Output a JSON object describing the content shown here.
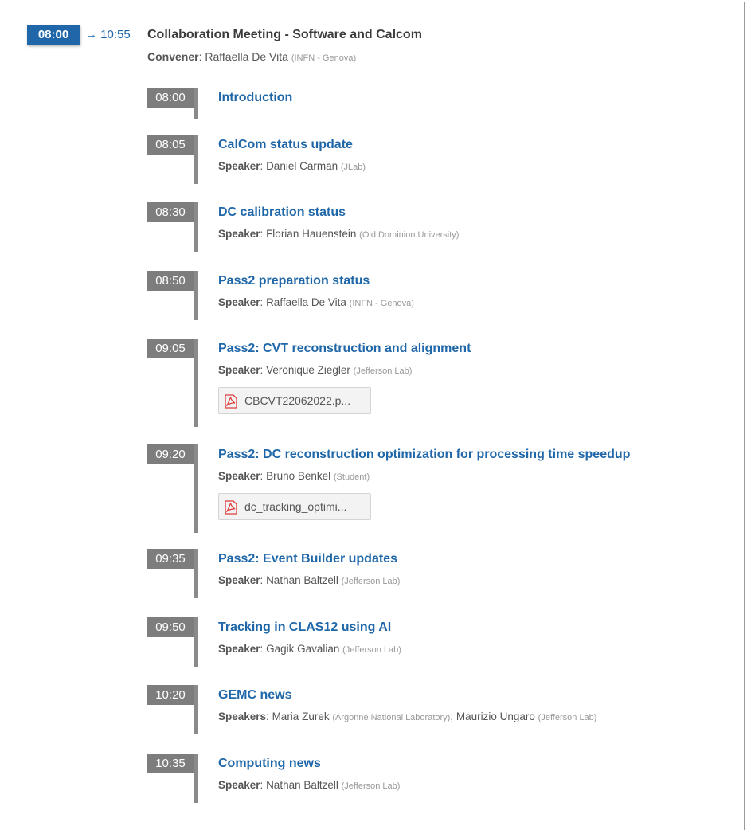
{
  "session": {
    "start": "08:00",
    "end": "→ 10:55",
    "title": "Collaboration Meeting - Software and Calcom",
    "convener_label": "Convener",
    "convener_name": "Raffaella De Vita",
    "convener_affiliation": "(INFN - Genova)"
  },
  "contributions": [
    {
      "time": "08:00",
      "title": "Introduction"
    },
    {
      "time": "08:05",
      "title": "CalCom status update",
      "speaker_label": "Speaker",
      "speaker": "Daniel Carman",
      "affiliation": "(JLab)"
    },
    {
      "time": "08:30",
      "title": "DC calibration status",
      "speaker_label": "Speaker",
      "speaker": "Florian Hauenstein",
      "affiliation": "(Old Dominion University)"
    },
    {
      "time": "08:50",
      "title": "Pass2 preparation status",
      "speaker_label": "Speaker",
      "speaker": "Raffaella De Vita",
      "affiliation": "(INFN - Genova)"
    },
    {
      "time": "09:05",
      "title": "Pass2: CVT reconstruction and alignment",
      "speaker_label": "Speaker",
      "speaker": "Veronique Ziegler",
      "affiliation": "(Jefferson Lab)",
      "attachment": "CBCVT22062022.p...",
      "attachment_icon": "pdf-icon"
    },
    {
      "time": "09:20",
      "title": "Pass2: DC reconstruction optimization for processing time speedup",
      "speaker_label": "Speaker",
      "speaker": "Bruno Benkel",
      "affiliation": "(Student)",
      "attachment": "dc_tracking_optimi...",
      "attachment_icon": "pdf-icon"
    },
    {
      "time": "09:35",
      "title": "Pass2: Event Builder updates",
      "speaker_label": "Speaker",
      "speaker": "Nathan Baltzell",
      "affiliation": "(Jefferson Lab)"
    },
    {
      "time": "09:50",
      "title": "Tracking in CLAS12 using AI",
      "speaker_label": "Speaker",
      "speaker": "Gagik Gavalian",
      "affiliation": "(Jefferson Lab)"
    },
    {
      "time": "10:20",
      "title": "GEMC news",
      "speaker_label": "Speakers",
      "speaker": "Maria Zurek",
      "affiliation": "(Argonne National Laboratory)",
      "separator": ",",
      "speaker2": "Maurizio Ungaro",
      "affiliation2": "(Jefferson Lab)"
    },
    {
      "time": "10:35",
      "title": "Computing news",
      "speaker_label": "Speaker",
      "speaker": "Nathan Baltzell",
      "affiliation": "(Jefferson Lab)"
    }
  ],
  "colors": {
    "accent": "#1f67a8",
    "time_badge": "#7d7d7d",
    "pdf_icon": "#e03b3b"
  }
}
